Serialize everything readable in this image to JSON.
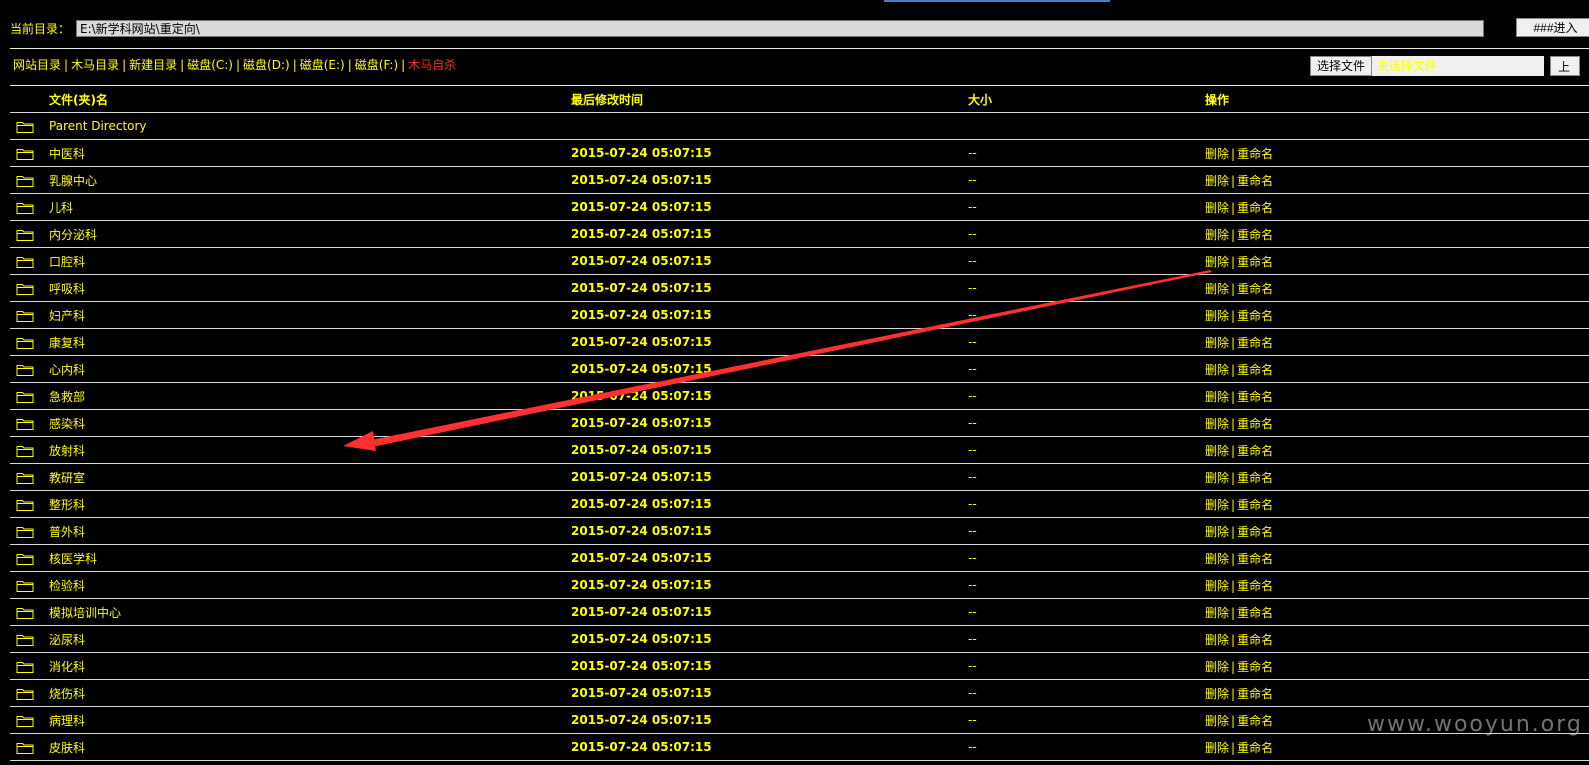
{
  "header": {
    "current_dir_label": "当前目录：",
    "current_dir_value": "E:\\新学科网站\\重定向\\",
    "enter_button": "###进入"
  },
  "nav": {
    "links": [
      "网站目录",
      "木马目录",
      "新建目录",
      "磁盘(C:)",
      "磁盘(D:)",
      "磁盘(E:)",
      "磁盘(F:)"
    ],
    "danger_link": "木马自杀",
    "separator": "|"
  },
  "upload": {
    "choose_button": "选择文件",
    "no_file_text": "未选择文件",
    "submit_button": "上"
  },
  "table": {
    "headers": {
      "name": "文件(夹)名",
      "time": "最后修改时间",
      "size": "大小",
      "ops": "操作"
    },
    "parent_label": "Parent Directory",
    "ops_delete": "删除",
    "ops_rename": "重命名",
    "ops_sep": "|",
    "rows": [
      {
        "name": "中医科",
        "time": "2015-07-24 05:07:15",
        "size": "--"
      },
      {
        "name": "乳腺中心",
        "time": "2015-07-24 05:07:15",
        "size": "--"
      },
      {
        "name": "儿科",
        "time": "2015-07-24 05:07:15",
        "size": "--"
      },
      {
        "name": "内分泌科",
        "time": "2015-07-24 05:07:15",
        "size": "--"
      },
      {
        "name": "口腔科",
        "time": "2015-07-24 05:07:15",
        "size": "--"
      },
      {
        "name": "呼吸科",
        "time": "2015-07-24 05:07:15",
        "size": "--"
      },
      {
        "name": "妇产科",
        "time": "2015-07-24 05:07:15",
        "size": "--"
      },
      {
        "name": "康复科",
        "time": "2015-07-24 05:07:15",
        "size": "--"
      },
      {
        "name": "心内科",
        "time": "2015-07-24 05:07:15",
        "size": "--"
      },
      {
        "name": "急救部",
        "time": "2015-07-24 05:07:15",
        "size": "--"
      },
      {
        "name": "感染科",
        "time": "2015-07-24 05:07:15",
        "size": "--"
      },
      {
        "name": "放射科",
        "time": "2015-07-24 05:07:15",
        "size": "--"
      },
      {
        "name": "教研室",
        "time": "2015-07-24 05:07:15",
        "size": "--"
      },
      {
        "name": "整形科",
        "time": "2015-07-24 05:07:15",
        "size": "--"
      },
      {
        "name": "普外科",
        "time": "2015-07-24 05:07:15",
        "size": "--"
      },
      {
        "name": "核医学科",
        "time": "2015-07-24 05:07:15",
        "size": "--"
      },
      {
        "name": "检验科",
        "time": "2015-07-24 05:07:15",
        "size": "--"
      },
      {
        "name": "模拟培训中心",
        "time": "2015-07-24 05:07:15",
        "size": "--"
      },
      {
        "name": "泌尿科",
        "time": "2015-07-24 05:07:15",
        "size": "--"
      },
      {
        "name": "消化科",
        "time": "2015-07-24 05:07:15",
        "size": "--"
      },
      {
        "name": "烧伤科",
        "time": "2015-07-24 05:07:15",
        "size": "--"
      },
      {
        "name": "病理科",
        "time": "2015-07-24 05:07:15",
        "size": "--"
      },
      {
        "name": "皮肤科",
        "time": "2015-07-24 05:07:15",
        "size": "--"
      }
    ]
  },
  "watermark": "www.wooyun.org",
  "icons": {
    "folder": "folder-icon",
    "annotation": "red-arrow"
  },
  "colors": {
    "background": "#000000",
    "text": "#ffff00",
    "danger": "#ff2a2a",
    "arrow": "#ff3030"
  }
}
